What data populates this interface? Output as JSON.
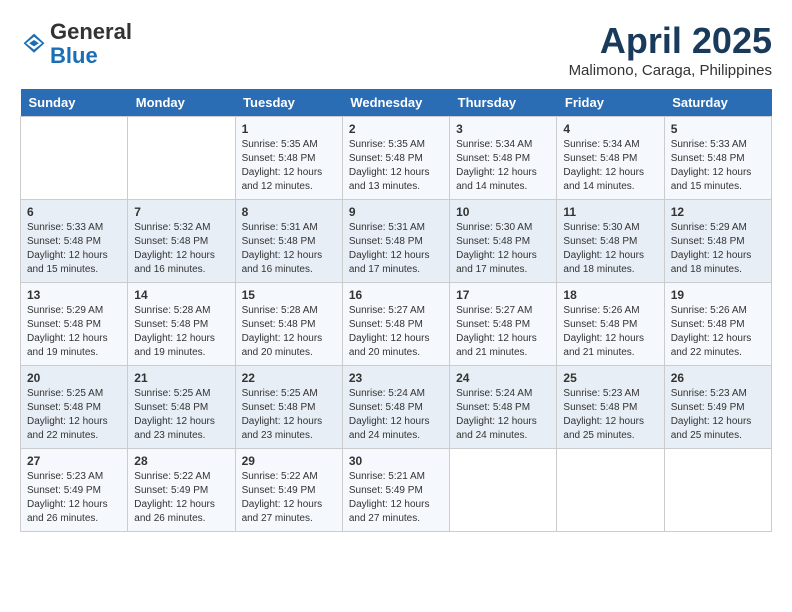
{
  "logo": {
    "general": "General",
    "blue": "Blue"
  },
  "header": {
    "title": "April 2025",
    "subtitle": "Malimono, Caraga, Philippines"
  },
  "weekdays": [
    "Sunday",
    "Monday",
    "Tuesday",
    "Wednesday",
    "Thursday",
    "Friday",
    "Saturday"
  ],
  "weeks": [
    [
      {
        "day": "",
        "details": ""
      },
      {
        "day": "",
        "details": ""
      },
      {
        "day": "1",
        "details": "Sunrise: 5:35 AM\nSunset: 5:48 PM\nDaylight: 12 hours and 12 minutes."
      },
      {
        "day": "2",
        "details": "Sunrise: 5:35 AM\nSunset: 5:48 PM\nDaylight: 12 hours and 13 minutes."
      },
      {
        "day": "3",
        "details": "Sunrise: 5:34 AM\nSunset: 5:48 PM\nDaylight: 12 hours and 14 minutes."
      },
      {
        "day": "4",
        "details": "Sunrise: 5:34 AM\nSunset: 5:48 PM\nDaylight: 12 hours and 14 minutes."
      },
      {
        "day": "5",
        "details": "Sunrise: 5:33 AM\nSunset: 5:48 PM\nDaylight: 12 hours and 15 minutes."
      }
    ],
    [
      {
        "day": "6",
        "details": "Sunrise: 5:33 AM\nSunset: 5:48 PM\nDaylight: 12 hours and 15 minutes."
      },
      {
        "day": "7",
        "details": "Sunrise: 5:32 AM\nSunset: 5:48 PM\nDaylight: 12 hours and 16 minutes."
      },
      {
        "day": "8",
        "details": "Sunrise: 5:31 AM\nSunset: 5:48 PM\nDaylight: 12 hours and 16 minutes."
      },
      {
        "day": "9",
        "details": "Sunrise: 5:31 AM\nSunset: 5:48 PM\nDaylight: 12 hours and 17 minutes."
      },
      {
        "day": "10",
        "details": "Sunrise: 5:30 AM\nSunset: 5:48 PM\nDaylight: 12 hours and 17 minutes."
      },
      {
        "day": "11",
        "details": "Sunrise: 5:30 AM\nSunset: 5:48 PM\nDaylight: 12 hours and 18 minutes."
      },
      {
        "day": "12",
        "details": "Sunrise: 5:29 AM\nSunset: 5:48 PM\nDaylight: 12 hours and 18 minutes."
      }
    ],
    [
      {
        "day": "13",
        "details": "Sunrise: 5:29 AM\nSunset: 5:48 PM\nDaylight: 12 hours and 19 minutes."
      },
      {
        "day": "14",
        "details": "Sunrise: 5:28 AM\nSunset: 5:48 PM\nDaylight: 12 hours and 19 minutes."
      },
      {
        "day": "15",
        "details": "Sunrise: 5:28 AM\nSunset: 5:48 PM\nDaylight: 12 hours and 20 minutes."
      },
      {
        "day": "16",
        "details": "Sunrise: 5:27 AM\nSunset: 5:48 PM\nDaylight: 12 hours and 20 minutes."
      },
      {
        "day": "17",
        "details": "Sunrise: 5:27 AM\nSunset: 5:48 PM\nDaylight: 12 hours and 21 minutes."
      },
      {
        "day": "18",
        "details": "Sunrise: 5:26 AM\nSunset: 5:48 PM\nDaylight: 12 hours and 21 minutes."
      },
      {
        "day": "19",
        "details": "Sunrise: 5:26 AM\nSunset: 5:48 PM\nDaylight: 12 hours and 22 minutes."
      }
    ],
    [
      {
        "day": "20",
        "details": "Sunrise: 5:25 AM\nSunset: 5:48 PM\nDaylight: 12 hours and 22 minutes."
      },
      {
        "day": "21",
        "details": "Sunrise: 5:25 AM\nSunset: 5:48 PM\nDaylight: 12 hours and 23 minutes."
      },
      {
        "day": "22",
        "details": "Sunrise: 5:25 AM\nSunset: 5:48 PM\nDaylight: 12 hours and 23 minutes."
      },
      {
        "day": "23",
        "details": "Sunrise: 5:24 AM\nSunset: 5:48 PM\nDaylight: 12 hours and 24 minutes."
      },
      {
        "day": "24",
        "details": "Sunrise: 5:24 AM\nSunset: 5:48 PM\nDaylight: 12 hours and 24 minutes."
      },
      {
        "day": "25",
        "details": "Sunrise: 5:23 AM\nSunset: 5:48 PM\nDaylight: 12 hours and 25 minutes."
      },
      {
        "day": "26",
        "details": "Sunrise: 5:23 AM\nSunset: 5:49 PM\nDaylight: 12 hours and 25 minutes."
      }
    ],
    [
      {
        "day": "27",
        "details": "Sunrise: 5:23 AM\nSunset: 5:49 PM\nDaylight: 12 hours and 26 minutes."
      },
      {
        "day": "28",
        "details": "Sunrise: 5:22 AM\nSunset: 5:49 PM\nDaylight: 12 hours and 26 minutes."
      },
      {
        "day": "29",
        "details": "Sunrise: 5:22 AM\nSunset: 5:49 PM\nDaylight: 12 hours and 27 minutes."
      },
      {
        "day": "30",
        "details": "Sunrise: 5:21 AM\nSunset: 5:49 PM\nDaylight: 12 hours and 27 minutes."
      },
      {
        "day": "",
        "details": ""
      },
      {
        "day": "",
        "details": ""
      },
      {
        "day": "",
        "details": ""
      }
    ]
  ]
}
